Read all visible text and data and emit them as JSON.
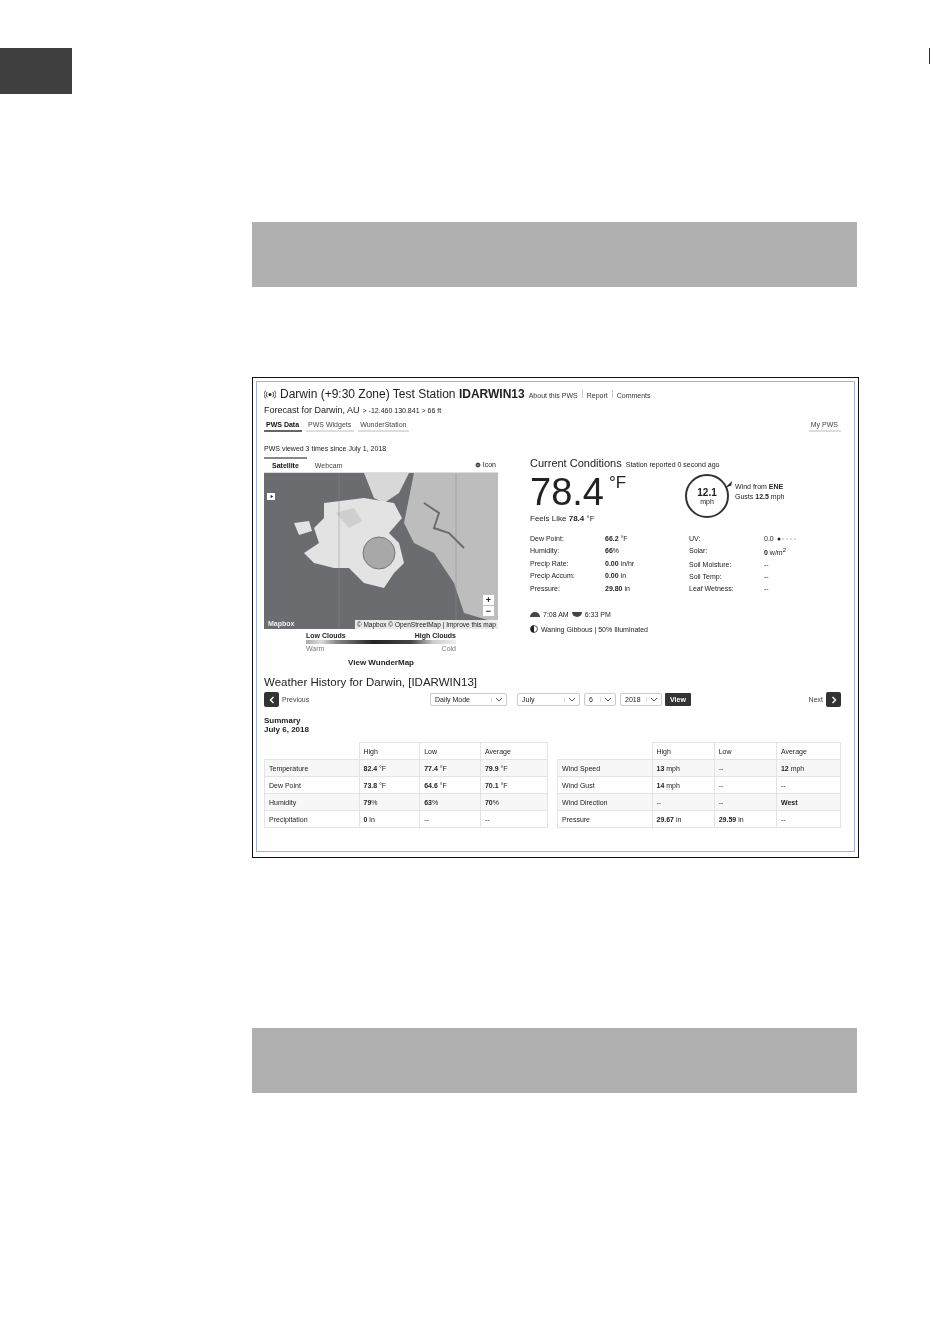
{
  "header": {
    "title": "Darwin (+9:30 Zone) Test Station **IDARWIN13**",
    "links": [
      "About this PWS",
      "Report",
      "Comments"
    ],
    "forecast": "Forecast for Darwin, AU",
    "location": "> -12.460 130.841 > 66 ft"
  },
  "tabs": [
    {
      "label": "PWS Data",
      "selected": true
    },
    {
      "label": "PWS Widgets",
      "selected": false
    },
    {
      "label": "WunderStation",
      "selected": false
    }
  ],
  "my_tab": {
    "label": "My PWS",
    "selected": false
  },
  "views": "PWS viewed 3 times since July 1, 2018",
  "map": {
    "tabs": [
      {
        "label": "Satellite",
        "selected": true
      },
      {
        "label": "Webcam",
        "selected": false
      }
    ],
    "icon_toggle": "Icon",
    "logo": "Mapbox",
    "attribution": "© Mapbox © OpenStreetMap | Improve this map",
    "zoom": [
      "+",
      "−"
    ],
    "legend": {
      "left": "Low Clouds",
      "right": "High Clouds",
      "low": "Warm",
      "high": "Cold"
    },
    "link": "View WunderMap"
  },
  "conditions": {
    "title": "Current Conditions",
    "reported": "Station reported 0 second ago",
    "temp": "78.4",
    "unit": "°F",
    "feels": "Feels Like **78.4** °F",
    "wind_speed": "12.1",
    "wind_unit": "mph",
    "wind_from": "Wind from **ENE**",
    "gusts": "Gusts **12.5** mph",
    "stats_left": [
      {
        "label": "Dew Point:",
        "value": "**66.2** °F"
      },
      {
        "label": "Humidity:",
        "value": "**66**%"
      },
      {
        "label": "Precip Rate:",
        "value": "**0.00** in/hr"
      },
      {
        "label": "Precip Accum:",
        "value": "**0.00** in"
      },
      {
        "label": "Pressure:",
        "value": "**29.80** in"
      }
    ],
    "stats_right": [
      {
        "label": "UV:",
        "value": "0.0"
      },
      {
        "label": "Solar:",
        "value": "**0** w/m$^{2}$"
      },
      {
        "label": "Soil Moisture:",
        "value": "--"
      },
      {
        "label": "Soil Temp:",
        "value": "--"
      },
      {
        "label": "Leaf Wetness:",
        "value": "--"
      }
    ],
    "sunrise": "7:08 AM",
    "sunset": "6:33 PM",
    "moon": "Waning Gibbous | 50% Illuminated"
  },
  "history": {
    "title": "Weather History for Darwin, [IDARWIN13]",
    "previous": "Previous",
    "next": "Next",
    "selects": [
      "Daily Mode",
      "July",
      "6",
      "2018"
    ],
    "view": "View",
    "summary": "Summary",
    "date": "July 6, 2018",
    "tables": [
      {
        "columns": [
          "High",
          "Low",
          "Average"
        ],
        "rows": [
          {
            "label": "Temperature",
            "cells": [
              "**82.4** °F",
              "**77.4** °F",
              "**79.9** °F"
            ]
          },
          {
            "label": "Dew Point",
            "cells": [
              "**73.8** °F",
              "**64.6** °F",
              "**70.1** °F"
            ]
          },
          {
            "label": "Humidity",
            "cells": [
              "**79**%",
              "**63**%",
              "**70**%"
            ]
          },
          {
            "label": "Precipitation",
            "cells": [
              "**0** in",
              "--",
              "--"
            ]
          }
        ]
      },
      {
        "columns": [
          "High",
          "Low",
          "Average"
        ],
        "rows": [
          {
            "label": "Wind Speed",
            "cells": [
              "**13** mph",
              "--",
              "**12** mph"
            ]
          },
          {
            "label": "Wind Gust",
            "cells": [
              "**14** mph",
              "--",
              "--"
            ]
          },
          {
            "label": "Wind Direction",
            "cells": [
              "--",
              "--",
              "**West**"
            ]
          },
          {
            "label": "Pressure",
            "cells": [
              "**29.67** in",
              "**29.59** in",
              "--"
            ]
          }
        ]
      }
    ]
  }
}
